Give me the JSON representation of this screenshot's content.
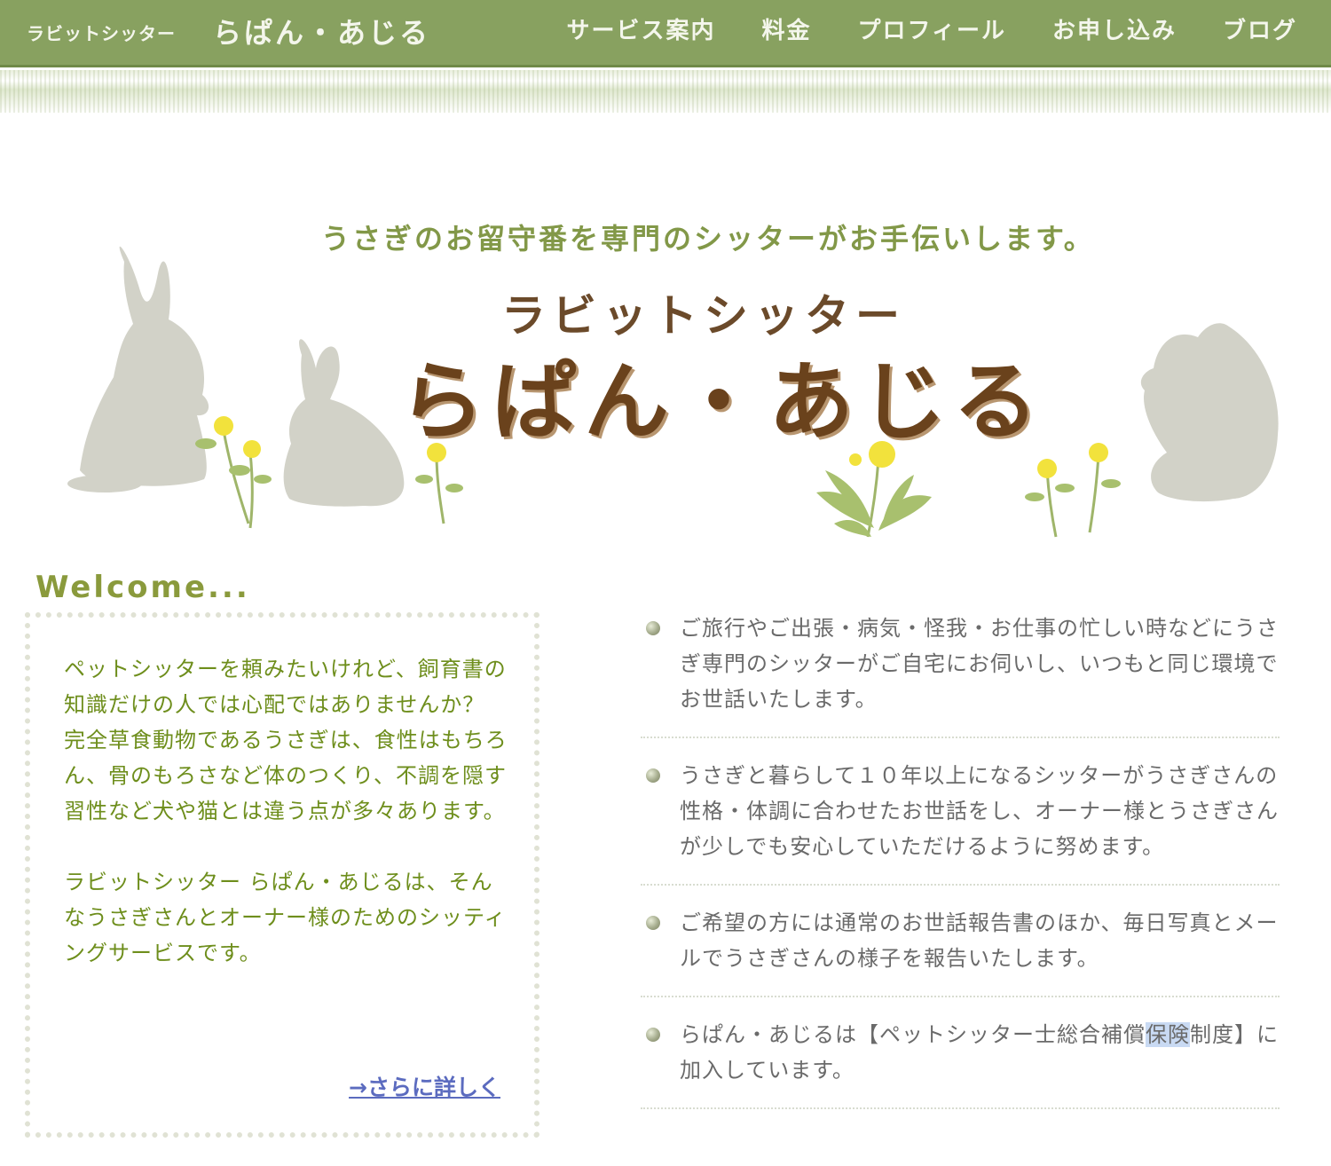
{
  "header": {
    "brand_small": "ラビットシッター",
    "brand_big": "らぱん・あじる",
    "nav": [
      "サービス案内",
      "料金",
      "プロフィール",
      "お申し込み",
      "ブログ"
    ]
  },
  "hero": {
    "tagline": "うさぎのお留守番を専門のシッターがお手伝いします。",
    "sub": "ラビットシッター",
    "title": "らぱん・あじる"
  },
  "welcome": {
    "heading": "Welcome...",
    "para1": "ペットシッターを頼みたいけれど、飼育書の知識だけの人では心配ではありませんか？",
    "para2": "完全草食動物であるうさぎは、食性はもちろん、骨のもろさなど体のつくり、不調を隠す習性など犬や猫とは違う点が多々あります。",
    "para3": "ラビットシッター らぱん・あじるは、そんなうさぎさんとオーナー様のためのシッティングサービスです。",
    "more_link": "→さらに詳しく"
  },
  "features": [
    "ご旅行やご出張・病気・怪我・お仕事の忙しい時などにうさぎ専門のシッターがご自宅にお伺いし、いつもと同じ環境でお世話いたします。",
    "うさぎと暮らして１０年以上になるシッターがうさぎさんの性格・体調に合わせたお世話をし、オーナー様とうさぎさんが少しでも安心していただけるように努めます。",
    "ご希望の方には通常のお世話報告書のほか、毎日写真とメールでうさぎさんの様子を報告いたします。"
  ],
  "feature4": {
    "before": "らぱん・あじるは【ペットシッター士総合補償",
    "highlight": "保険",
    "after": "制度】に加入しています。"
  },
  "colors": {
    "nav_bg": "#88a160",
    "welcome_text": "#6e8e1c",
    "link": "#5b6bbf",
    "title_brown": "#6a421c",
    "selection": "#c9daf3"
  }
}
